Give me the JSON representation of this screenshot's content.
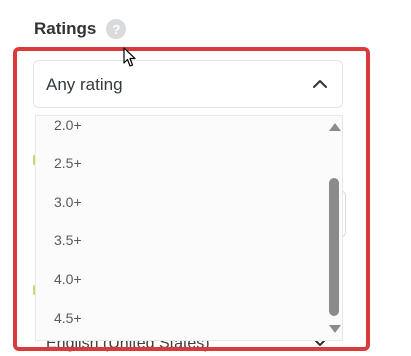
{
  "section": {
    "title": "Ratings",
    "help_icon": "question-mark-icon",
    "help_glyph": "?"
  },
  "select": {
    "value": "Any rating",
    "chevron_icon": "chevron-up-icon",
    "options": [
      "2.0+",
      "2.5+",
      "3.0+",
      "3.5+",
      "4.0+",
      "4.5+"
    ]
  },
  "background": {
    "language_field_value": "English (United States)"
  },
  "colors": {
    "highlight": "#d93a3a",
    "scroll_thumb": "#8b8b8b",
    "side_marker": "#c9d86a"
  }
}
